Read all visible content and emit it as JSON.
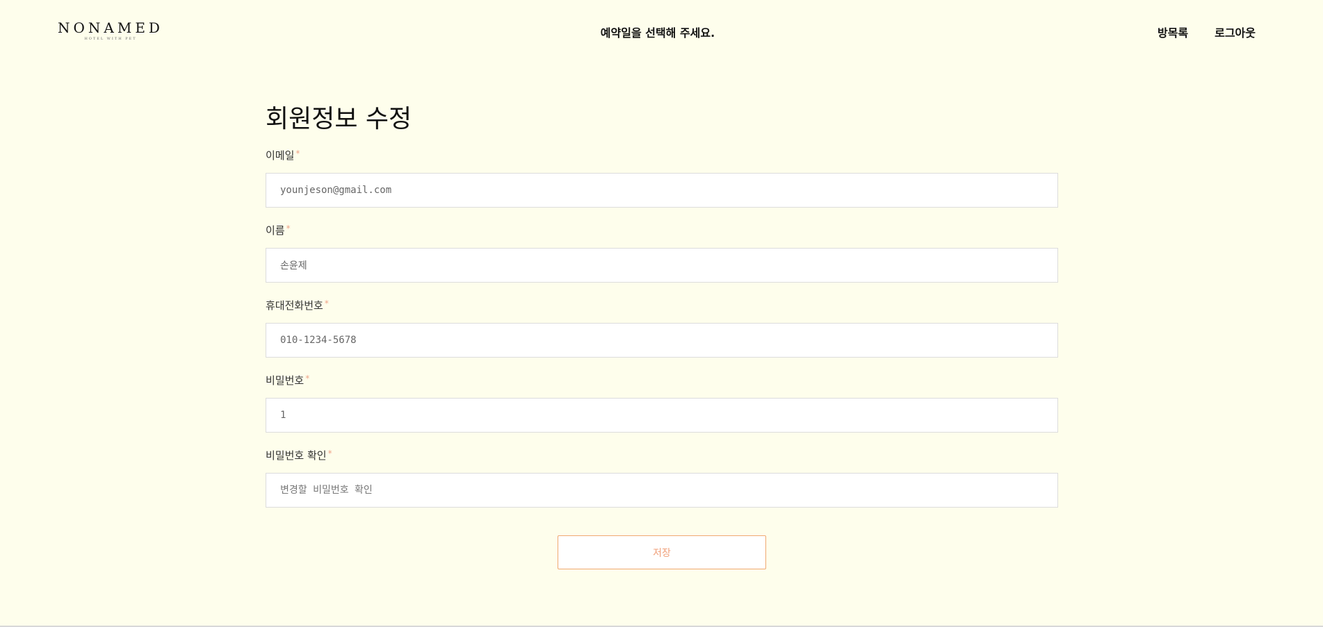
{
  "header": {
    "logo_main": "NONAMED",
    "logo_sub": "HOTEL WITH PET",
    "center_text": "예약일을 선택해 주세요.",
    "nav": {
      "rooms_label": "방목록",
      "logout_label": "로그아웃"
    }
  },
  "form": {
    "title": "회원정보 수정",
    "required_mark": "*",
    "fields": {
      "email": {
        "label": "이메일",
        "value": "younjeson@gmail.com"
      },
      "name": {
        "label": "이름",
        "value": "손윤제"
      },
      "phone": {
        "label": "휴대전화번호",
        "value": "010-1234-5678"
      },
      "password": {
        "label": "비밀번호",
        "value": "1"
      },
      "password_confirm": {
        "label": "비밀번호 확인",
        "placeholder": "변경할 비밀번호 확인"
      }
    },
    "save_label": "저장"
  },
  "colors": {
    "background": "#fefeec",
    "accent": "#f0a870",
    "required": "#f0a58a"
  }
}
